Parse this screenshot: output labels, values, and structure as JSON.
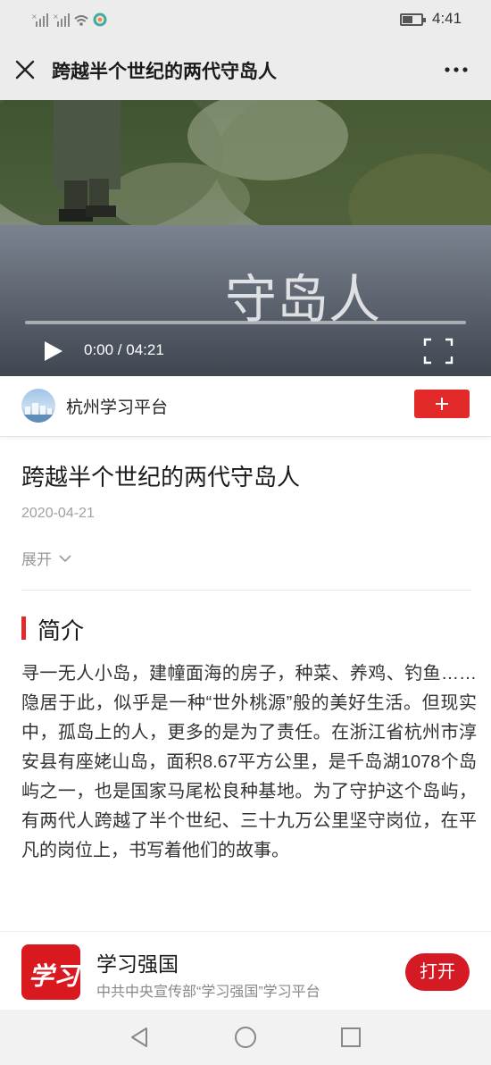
{
  "status_bar": {
    "time": "4:41",
    "battery_level": 0.55
  },
  "header": {
    "title": "跨越半个世纪的两代守岛人"
  },
  "video": {
    "watermark_text": "守岛人",
    "current_time": "0:00",
    "duration": "04:21",
    "time_display": "0:00 / 04:21",
    "progress": 0
  },
  "publisher": {
    "name": "杭州学习平台"
  },
  "article": {
    "title": "跨越半个世纪的两代守岛人",
    "date": "2020-04-21",
    "expand_label": "展开"
  },
  "intro": {
    "heading": "简介",
    "text": "寻一无人小岛，建幢面海的房子，种菜、养鸡、钓鱼……隐居于此，似乎是一种“世外桃源”般的美好生活。但现实中，孤岛上的人，更多的是为了责任。在浙江省杭州市淳安县有座姥山岛，面积8.67平方公里，是千岛湖1078个岛屿之一，也是国家马尾松良种基地。为了守护这个岛屿，有两代人跨越了半个世纪、三十九万公里坚守岗位，在平凡的岗位上，书写着他们的故事。"
  },
  "app_banner": {
    "logo_text": "学习",
    "name": "学习强国",
    "description": "中共中央宣传部“学习强国”学习平台",
    "open_label": "打开"
  },
  "colors": {
    "accent": "#e32a2a",
    "open_button": "#d41b24"
  }
}
